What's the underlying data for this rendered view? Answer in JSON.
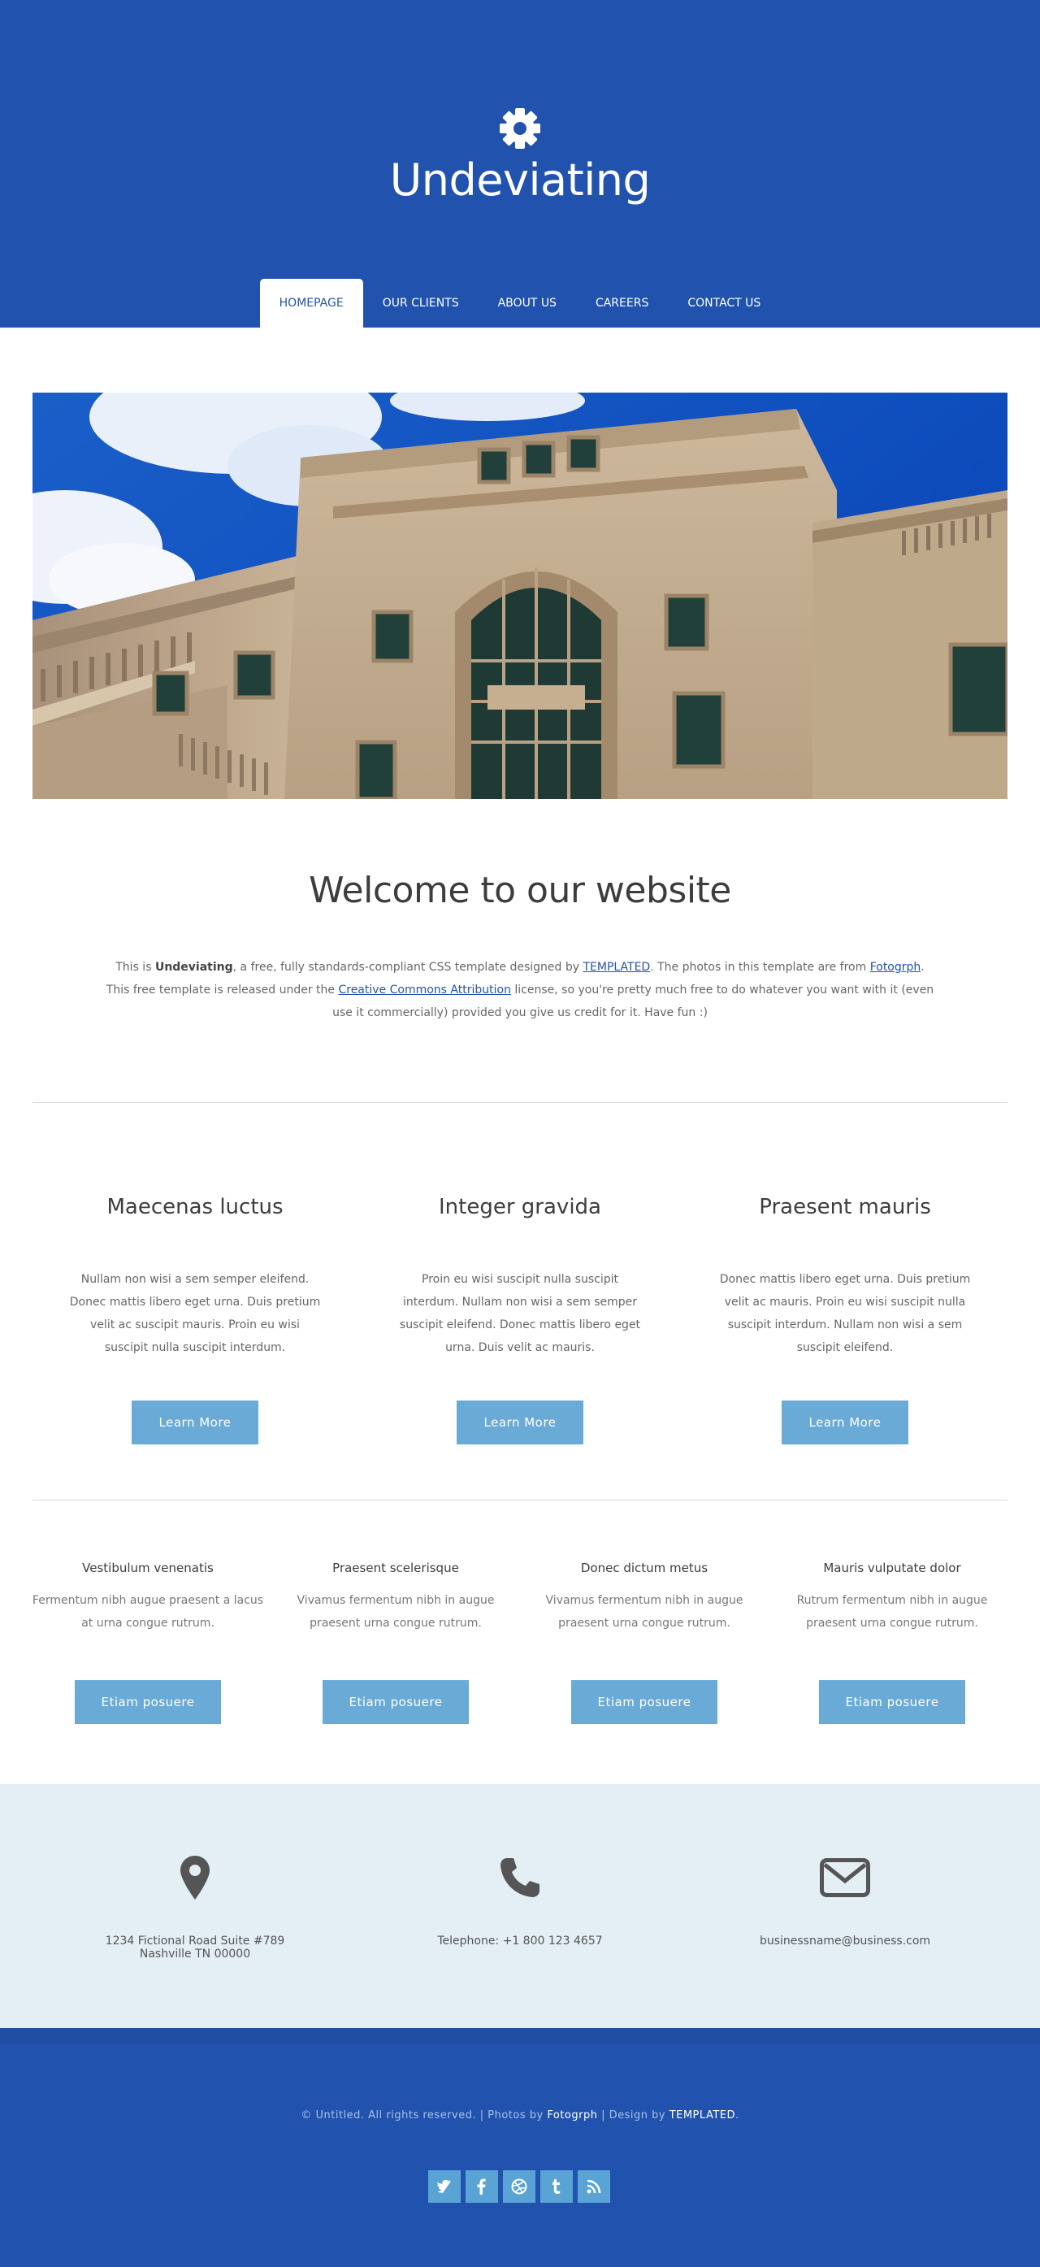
{
  "header": {
    "title": "Undeviating",
    "logo_icon": "gear-icon",
    "nav": [
      {
        "label": "HOMEPAGE",
        "active": true
      },
      {
        "label": "OUR CLIENTS",
        "active": false
      },
      {
        "label": "ABOUT US",
        "active": false
      },
      {
        "label": "CAREERS",
        "active": false
      },
      {
        "label": "CONTACT US",
        "active": false
      }
    ]
  },
  "welcome": {
    "title": "Welcome to our website",
    "p1_a": "This is ",
    "site_name": "Undeviating",
    "p1_b": ", a free, fully standards-compliant CSS template designed by ",
    "templated_link": "TEMPLATED",
    "p1_c": ". The photos in this template are from ",
    "fotogrph_link": "Fotogrph",
    "p1_d": ".",
    "p2_a": "This free template is released under the ",
    "cc_link": "Creative Commons Attribution",
    "p2_b": " license, so you're pretty much free to do whatever you want with it (even use it commercially) provided you give us credit for it. Have fun :)"
  },
  "features": [
    {
      "title": "Maecenas luctus",
      "text": "Nullam non wisi a sem semper eleifend. Donec mattis libero eget urna. Duis pretium velit ac suscipit mauris. Proin eu wisi suscipit nulla suscipit interdum.",
      "button": "Learn More"
    },
    {
      "title": "Integer gravida",
      "text": "Proin eu wisi suscipit nulla suscipit interdum. Nullam non wisi a sem semper suscipit eleifend. Donec mattis libero eget urna. Duis velit ac mauris.",
      "button": "Learn More"
    },
    {
      "title": "Praesent mauris",
      "text": "Donec mattis libero eget urna. Duis pretium velit ac mauris. Proin eu wisi suscipit nulla suscipit interdum. Nullam non wisi a sem suscipit eleifend.",
      "button": "Learn More"
    }
  ],
  "boxes": [
    {
      "title": "Vestibulum venenatis",
      "text": "Fermentum nibh augue praesent a lacus at urna congue rutrum.",
      "button": "Etiam posuere"
    },
    {
      "title": "Praesent scelerisque",
      "text": "Vivamus fermentum nibh in augue praesent urna congue rutrum.",
      "button": "Etiam posuere"
    },
    {
      "title": "Donec dictum metus",
      "text": "Vivamus fermentum nibh in augue praesent urna congue rutrum.",
      "button": "Etiam posuere"
    },
    {
      "title": "Mauris vulputate dolor",
      "text": "Rutrum fermentum nibh in augue praesent urna congue rutrum.",
      "button": "Etiam posuere"
    }
  ],
  "contact": {
    "address_line1": "1234 Fictional Road Suite #789",
    "address_line2": "Nashville TN 00000",
    "phone": "Telephone: +1 800 123 4657",
    "email": "businessname@business.com",
    "icons": [
      "map-marker-icon",
      "phone-icon",
      "envelope-icon"
    ]
  },
  "footer": {
    "copy_a": "© Untitled. All rights reserved. | Photos by ",
    "copy_fotogrph": "Fotogrph",
    "copy_b": " | Design by ",
    "copy_templated": "TEMPLATED",
    "copy_c": ".",
    "social": [
      "twitter-icon",
      "facebook-icon",
      "dribbble-icon",
      "tumblr-icon",
      "rss-icon"
    ]
  },
  "colors": {
    "brand_blue": "#2153ae",
    "button": "#6aaad6",
    "contact_bg": "#e3eef5",
    "social": "#5aa3d5"
  }
}
